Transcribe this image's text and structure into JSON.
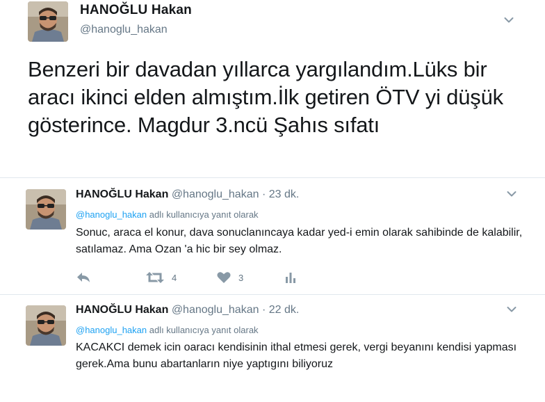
{
  "main_tweet": {
    "name": "HANOĞLU Hakan",
    "handle": "@hanoglu_hakan",
    "text": "Benzeri bir davadan yıllarca yargılandım.Lüks bir aracı ikinci elden almıştım.İlk getiren ÖTV yi düşük gösterince. Magdur 3.ncü Şahıs sıfatı",
    "menu_icon": "chevron-down-icon"
  },
  "replies": [
    {
      "name": "HANOĞLU Hakan",
      "handle": "@hanoglu_hakan",
      "separator": "·",
      "time": "23 dk.",
      "reply_to_handle": "@hanoglu_hakan",
      "reply_to_suffix": " adlı kullanıcıya yanıt olarak",
      "text": "Sonuc, araca el konur, dava sonuclanıncaya kadar yed-i emin olarak sahibinde de kalabilir, satılamaz. Ama Ozan 'a hic bir sey olmaz.",
      "retweets": "4",
      "likes": "3",
      "icons": [
        "reply-icon",
        "retweet-icon",
        "heart-icon",
        "analytics-icon"
      ]
    },
    {
      "name": "HANOĞLU Hakan",
      "handle": "@hanoglu_hakan",
      "separator": "·",
      "time": "22 dk.",
      "reply_to_handle": "@hanoglu_hakan",
      "reply_to_suffix": " adlı kullanıcıya yanıt olarak",
      "text": "KACAKCI demek icin oaracı kendisinin ithal etmesi gerek, vergi beyanını kendisi yapması gerek.Ama bunu abartanların niye yaptıgını biliyoruz"
    }
  ],
  "colors": {
    "text": "#14171a",
    "secondary": "#657786",
    "link": "#1da1f2",
    "divider": "#e1e8ed",
    "action_icon": "#8899a6"
  }
}
